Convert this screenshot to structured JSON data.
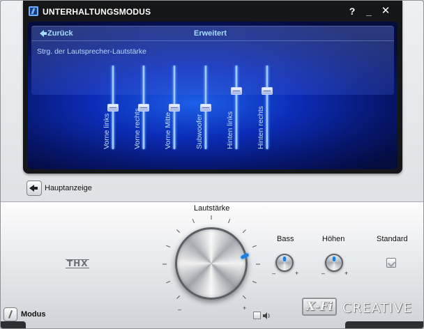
{
  "window": {
    "title": "UNTERHALTUNGSMODUS",
    "help": "?",
    "minimize": "_",
    "close": "✕"
  },
  "panel": {
    "back_label": "Zurück",
    "mode_label": "Erweitert",
    "section_label": "Strg. der Lautsprecher-Lautstärke",
    "sliders": [
      {
        "label": "Vorne links",
        "level": 0.5
      },
      {
        "label": "Vorne rechts",
        "level": 0.5
      },
      {
        "label": "Vorne Mitte",
        "level": 0.5
      },
      {
        "label": "Subwoofer",
        "level": 0.5
      },
      {
        "label": "Hinten links",
        "level": 0.72
      },
      {
        "label": "Hinten rechts",
        "level": 0.72
      }
    ]
  },
  "main_view": {
    "label": "Hauptanzeige"
  },
  "controls": {
    "volume_label": "Lautstärke",
    "bass_label": "Bass",
    "treble_label": "Höhen",
    "standard_label": "Standard",
    "minus": "–",
    "plus": "+"
  },
  "logos": {
    "thx": "THX",
    "xfi": "X-Fi",
    "creative": "CREATIVE"
  },
  "footer": {
    "mode_label": "Modus"
  },
  "colors": {
    "accent": "#1b7fe0",
    "panel_blue": "#0b2cb5",
    "label_cyan": "#a8ddff"
  }
}
